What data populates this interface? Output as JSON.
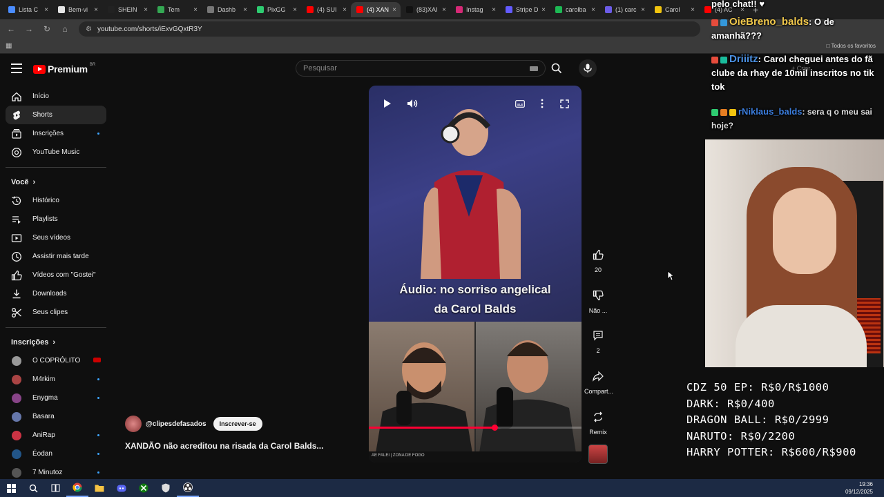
{
  "browser": {
    "tabs": [
      {
        "title": "Lista C",
        "color": "#4a8cff"
      },
      {
        "title": "Bem-vi",
        "color": "#e6e6e6"
      },
      {
        "title": "SHEIN",
        "color": "#222222"
      },
      {
        "title": "Tem",
        "color": "#34a853"
      },
      {
        "title": "Dashb",
        "color": "#777777"
      },
      {
        "title": "PixGG",
        "color": "#2ecc71"
      },
      {
        "title": "(4) SUI",
        "color": "#ff0000"
      },
      {
        "title": "(4) XAN",
        "color": "#ff0000",
        "active": true
      },
      {
        "title": "(83)XAI",
        "color": "#111111"
      },
      {
        "title": "Instag",
        "color": "#d62976"
      },
      {
        "title": "Stripe D",
        "color": "#635bff"
      },
      {
        "title": "carolba",
        "color": "#1db954"
      },
      {
        "title": "(1) carc",
        "color": "#6c5ce7"
      },
      {
        "title": "Carol",
        "color": "#f1c40f"
      },
      {
        "title": "(4) AC",
        "color": "#ff0000"
      }
    ],
    "new_tab": "+",
    "url": "youtube.com/shorts/iExvGQxtR3Y",
    "bookmarks_all": "Todos os favoritos"
  },
  "header": {
    "logo_text": "Premium",
    "logo_region": "BR",
    "search_placeholder": "Pesquisar",
    "create_label": "Criar"
  },
  "sidebar": {
    "main": [
      {
        "label": "Início",
        "icon": "home-icon"
      },
      {
        "label": "Shorts",
        "icon": "shorts-icon",
        "active": true
      },
      {
        "label": "Inscrições",
        "icon": "subscriptions-icon",
        "dot": true
      },
      {
        "label": "YouTube Music",
        "icon": "music-icon"
      }
    ],
    "you_heading": "Você",
    "you": [
      {
        "label": "Histórico",
        "icon": "history-icon"
      },
      {
        "label": "Playlists",
        "icon": "playlists-icon"
      },
      {
        "label": "Seus vídeos",
        "icon": "your-videos-icon"
      },
      {
        "label": "Assistir mais tarde",
        "icon": "watch-later-icon"
      },
      {
        "label": "Vídeos com \"Gostei\"",
        "icon": "like-icon"
      },
      {
        "label": "Downloads",
        "icon": "download-icon"
      },
      {
        "label": "Seus clipes",
        "icon": "scissors-icon"
      }
    ],
    "subs_heading": "Inscrições",
    "subs": [
      {
        "label": "O COPRÓLITO",
        "color": "#999999",
        "live": true
      },
      {
        "label": "M4rkim",
        "color": "#aa4444",
        "dot": true
      },
      {
        "label": "Enygma",
        "color": "#884488",
        "dot": true
      },
      {
        "label": "Basara",
        "color": "#6677aa"
      },
      {
        "label": "AniRap",
        "color": "#cc3344",
        "dot": true
      },
      {
        "label": "Éodan",
        "color": "#225588",
        "dot": true
      },
      {
        "label": "7 Minutoz",
        "color": "#555555",
        "dot": true
      }
    ]
  },
  "short": {
    "caption_line1": "Áudio: no sorriso angelical",
    "caption_line2": "da Carol Balds",
    "bottom_strip": "AE FALEI | ZONA DE FOGO",
    "progress": 0.59,
    "channel": "@clipesdefasados",
    "subscribe_label": "Inscrever-se",
    "title": "XANDÃO não acreditou na risada da Carol Balds..."
  },
  "actions": {
    "like_count": "20",
    "dislike_label": "Não ...",
    "comments_count": "2",
    "share_label": "Compart...",
    "remix_label": "Remix"
  },
  "chat": {
    "line0": "pelo chat!! ♥",
    "m1_user": "OieBreno_balds",
    "m1_text": ": O de amanhã???",
    "m2_user": "Driiitz",
    "m2_text": ": Carol cheguei antes do fã clube da rhay de 10mil inscritos no tik tok",
    "m3_user": "rNiklaus_balds",
    "m3_text": ": sera q o meu sai hoje?",
    "user_colors": {
      "m1": "#f2c94c",
      "m2": "#4a90e2",
      "m3": "#3b7ddd"
    }
  },
  "prices": [
    "CDZ 50 EP: R$0/R$1000",
    "DARK: R$0/400",
    "DRAGON BALL: R$0/2999",
    "NARUTO: R$0/2200",
    "HARRY POTTER: R$600/R$900"
  ],
  "taskbar": {
    "time": "19:36",
    "date": "09/12/2025"
  }
}
